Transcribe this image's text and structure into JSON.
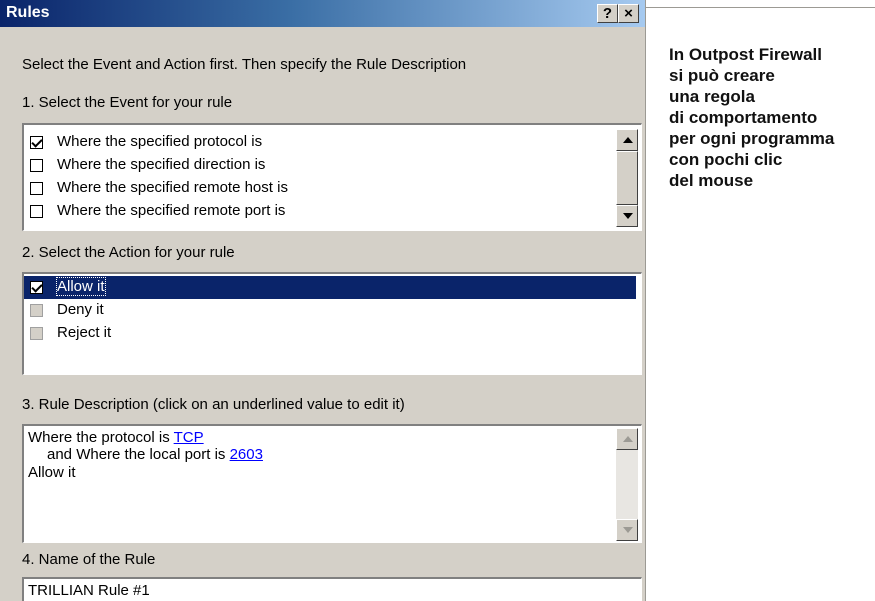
{
  "dialog": {
    "title": "Rules",
    "help_button": "?",
    "close_button": "×",
    "instruction": "Select the Event and Action first. Then specify the Rule Description",
    "event_section": {
      "label": "1. Select the Event for your rule",
      "items": [
        {
          "label": "Where the specified protocol is",
          "checked": true
        },
        {
          "label": "Where the specified direction is",
          "checked": false
        },
        {
          "label": "Where the specified remote host is",
          "checked": false
        },
        {
          "label": "Where the specified remote port is",
          "checked": false
        }
      ]
    },
    "action_section": {
      "label": "2. Select the Action for your rule",
      "items": [
        {
          "label": "Allow it",
          "checked": true,
          "selected": true
        },
        {
          "label": "Deny it",
          "checked": false
        },
        {
          "label": "Reject it",
          "checked": false
        }
      ]
    },
    "description_section": {
      "label": "3. Rule Description (click on an underlined value to edit it)",
      "line1_prefix": "Where the protocol is ",
      "line1_value": "TCP",
      "line2_prefix": "and Where the local port is ",
      "line2_value": "2603",
      "line3": "Allow it"
    },
    "name_section": {
      "label": "4. Name of the Rule",
      "value": "TRILLIAN Rule #1"
    }
  },
  "caption": {
    "lines": [
      "In Outpost Firewall",
      "si può creare",
      "una regola",
      "di comportamento",
      "per ogni programma",
      "con pochi clic",
      "del mouse"
    ]
  },
  "colors": {
    "title_bar": "#0a246a",
    "selection": "#0a246a",
    "link": "#0000ff",
    "dialog_face": "#d4d0c8"
  }
}
